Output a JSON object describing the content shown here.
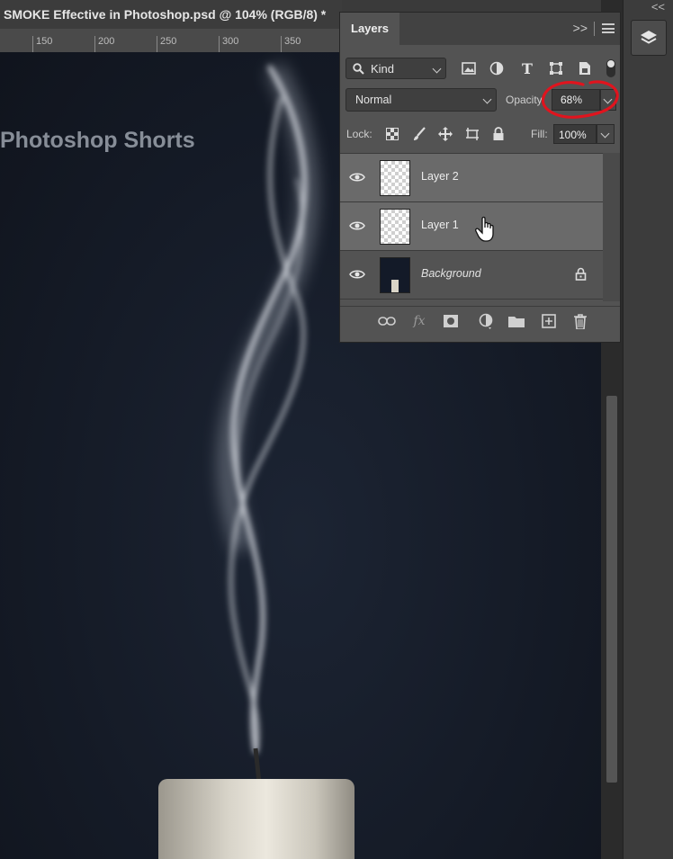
{
  "document": {
    "tab_title": "SMOKE Effective in Photoshop.psd @ 104% (RGB/8) *",
    "ruler_ticks": [
      "150",
      "200",
      "250",
      "300",
      "350"
    ]
  },
  "canvas": {
    "watermark": "Photoshop Shorts",
    "background_color": "#151b27"
  },
  "layers_panel": {
    "tab_label": "Layers",
    "expand_label": ">>",
    "filter": {
      "kind_label": "Kind",
      "icons": [
        "pixel-filter-icon",
        "adjustment-filter-icon",
        "type-filter-icon",
        "shape-filter-icon",
        "smart-object-filter-icon"
      ]
    },
    "blend_mode": "Normal",
    "opacity_label": "Opacity:",
    "opacity_value": "68%",
    "lock_label": "Lock:",
    "fill_label": "Fill:",
    "fill_value": "100%",
    "layers": [
      {
        "name": "Layer 2",
        "visible": true,
        "selected": true,
        "locked": false
      },
      {
        "name": "Layer 1",
        "visible": true,
        "selected": true,
        "locked": false
      },
      {
        "name": "Background",
        "visible": true,
        "selected": false,
        "locked": true
      }
    ],
    "footer_icons": [
      "link-layers-icon",
      "fx-icon",
      "add-mask-icon",
      "adjustment-layer-icon",
      "new-group-icon",
      "new-layer-icon",
      "delete-layer-icon"
    ],
    "annotation_color": "#e0141e"
  },
  "dock": {
    "collapse_label": "<<"
  }
}
